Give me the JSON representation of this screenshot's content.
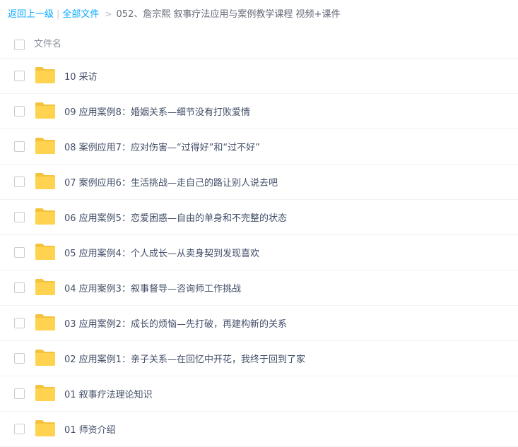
{
  "breadcrumb": {
    "back": "返回上一级",
    "separator": "|",
    "all_files": "全部文件",
    "arrow": ">",
    "current": "052、詹宗熙 叙事疗法应用与案例教学课程 视频+课件"
  },
  "list": {
    "header": "文件名",
    "items": [
      {
        "name": "10 采访"
      },
      {
        "name": "09 应用案例8：婚姻关系—细节没有打败爱情"
      },
      {
        "name": "08 案例应用7：应对伤害—“过得好”和“过不好”"
      },
      {
        "name": "07 案例应用6：生活挑战—走自己的路让别人说去吧"
      },
      {
        "name": "06 应用案例5：恋爱困惑—自由的单身和不完整的状态"
      },
      {
        "name": "05 应用案例4：个人成长—从卖身契到发现喜欢"
      },
      {
        "name": "04 应用案例3：叙事督导—咨询师工作挑战"
      },
      {
        "name": "03 应用案例2：成长的烦恼—先打破，再建构新的关系"
      },
      {
        "name": "02 应用案例1：亲子关系—在回忆中开花，我终于回到了家"
      },
      {
        "name": "01 叙事疗法理论知识"
      },
      {
        "name": "01 师资介绍"
      }
    ]
  },
  "colors": {
    "link": "#09aaff",
    "folder": "#ffd34f",
    "folder_tab": "#f5c23c"
  },
  "icons": {
    "folder": "folder-icon",
    "checkbox": "checkbox-icon"
  }
}
